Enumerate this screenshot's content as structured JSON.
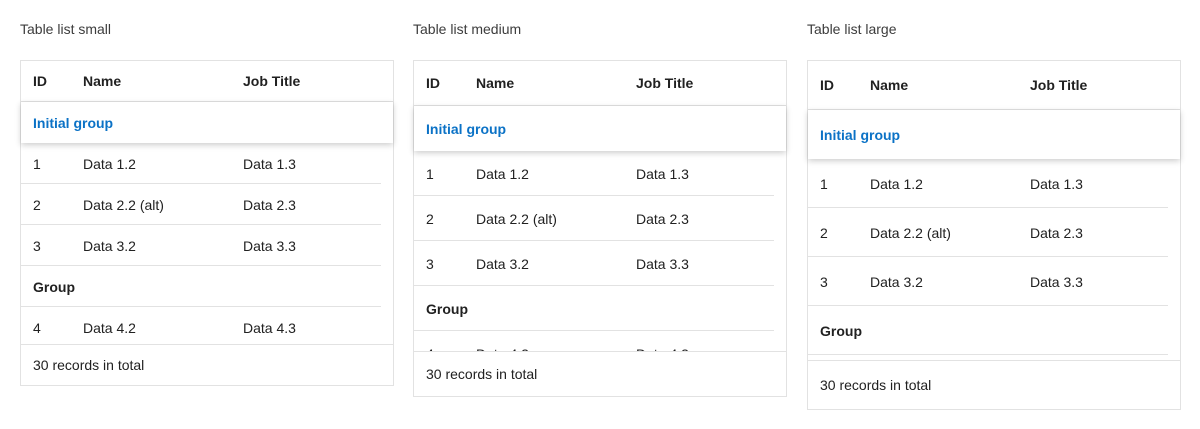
{
  "columns": {
    "id": "ID",
    "name": "Name",
    "job_title": "Job Title"
  },
  "initial_group_label": "Initial group",
  "group_label": "Group",
  "rows": [
    {
      "id": "1",
      "name": "Data 1.2",
      "job": "Data 1.3"
    },
    {
      "id": "2",
      "name": "Data 2.2 (alt)",
      "job": "Data 2.3"
    },
    {
      "id": "3",
      "name": "Data 3.2",
      "job": "Data 3.3"
    },
    {
      "id": "4",
      "name": "Data 4.2",
      "job": "Data 4.3"
    }
  ],
  "footer_text": "30 records in total",
  "variants": {
    "small": {
      "title": "Table list small"
    },
    "medium": {
      "title": "Table list medium"
    },
    "large": {
      "title": "Table list large"
    }
  },
  "colors": {
    "group_accent": "#0b72c6",
    "border": "#e2e2e2"
  }
}
